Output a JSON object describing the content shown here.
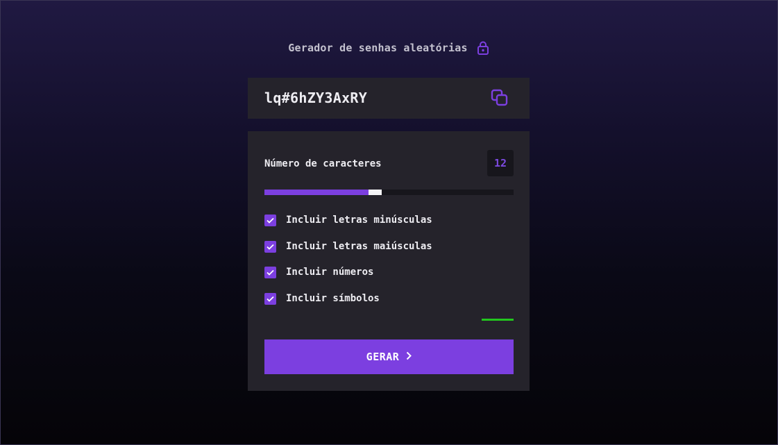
{
  "header": {
    "title": "Gerador de senhas aleatórias",
    "icon": "lock-icon"
  },
  "password": {
    "value": "lq#6hZY3AxRY",
    "copy_icon": "copy-icon"
  },
  "length": {
    "label": "Número de caracteres",
    "value": "12",
    "slider_fraction": 0.44
  },
  "options": [
    {
      "label": "Incluir letras minúsculas",
      "checked": true
    },
    {
      "label": "Incluir letras maiúsculas",
      "checked": true
    },
    {
      "label": "Incluir números",
      "checked": true
    },
    {
      "label": "Incluir símbolos",
      "checked": true
    }
  ],
  "strength": {
    "color": "#22c61e"
  },
  "generate": {
    "label": "GERAR",
    "icon": "chevron-right-icon"
  },
  "colors": {
    "accent": "#7c3fe0",
    "panel": "#25232b",
    "strength": "#22c61e"
  }
}
